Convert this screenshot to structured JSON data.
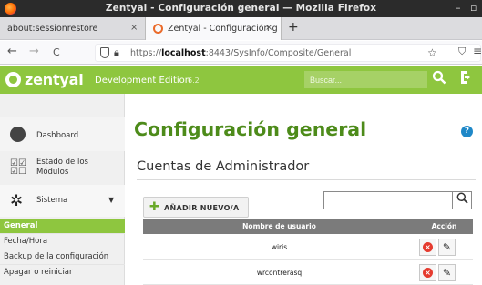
{
  "window": {
    "title": "Zentyal - Configuración general — Mozilla Firefox",
    "controls": [
      "–",
      "▫"
    ]
  },
  "tabs": [
    {
      "label": "about:sessionrestore",
      "close": "×"
    },
    {
      "label": "Zentyal - Configuración g",
      "close": "×"
    }
  ],
  "new_tab": "+",
  "nav": {
    "back": "←",
    "forward": "→",
    "reload": "C",
    "url_prefix": "https://",
    "url_host": "localhost",
    "url_rest": ":8443/SysInfo/Composite/General",
    "bookmark": "☆",
    "pocket": "⛉",
    "menu": "≡"
  },
  "app": {
    "brand": "zentyal",
    "edition": "Development Edition",
    "version": "6.2",
    "search_placeholder": "Buscar...",
    "search_icon": "search-icon",
    "logout_icon": "logout-icon"
  },
  "sidebar": {
    "items": [
      {
        "label": "Dashboard",
        "icon": "dashboard-icon"
      },
      {
        "label": "Estado de los Módulos",
        "icon": "modules-status-icon"
      },
      {
        "label": "Sistema",
        "icon": "gear-icon"
      }
    ],
    "subitems": [
      {
        "label": "General",
        "active": true
      },
      {
        "label": "Fecha/Hora"
      },
      {
        "label": "Backup de la configuración"
      },
      {
        "label": "Apagar o reiniciar"
      }
    ]
  },
  "main": {
    "page_title": "Configuración general",
    "section_title": "Cuentas de Administrador",
    "add_button": "AÑADIR NUEVO/A",
    "table": {
      "headers": [
        "Nombre de usuario",
        "Acción"
      ],
      "rows": [
        {
          "username": "wiris"
        },
        {
          "username": "wrcontrerasq"
        }
      ]
    }
  },
  "colors": {
    "accent": "#8ec63f",
    "title_green": "#4d8b1a",
    "table_header": "#7b7b7b",
    "delete_red": "#e53b2f",
    "help_blue": "#1f88c8"
  }
}
